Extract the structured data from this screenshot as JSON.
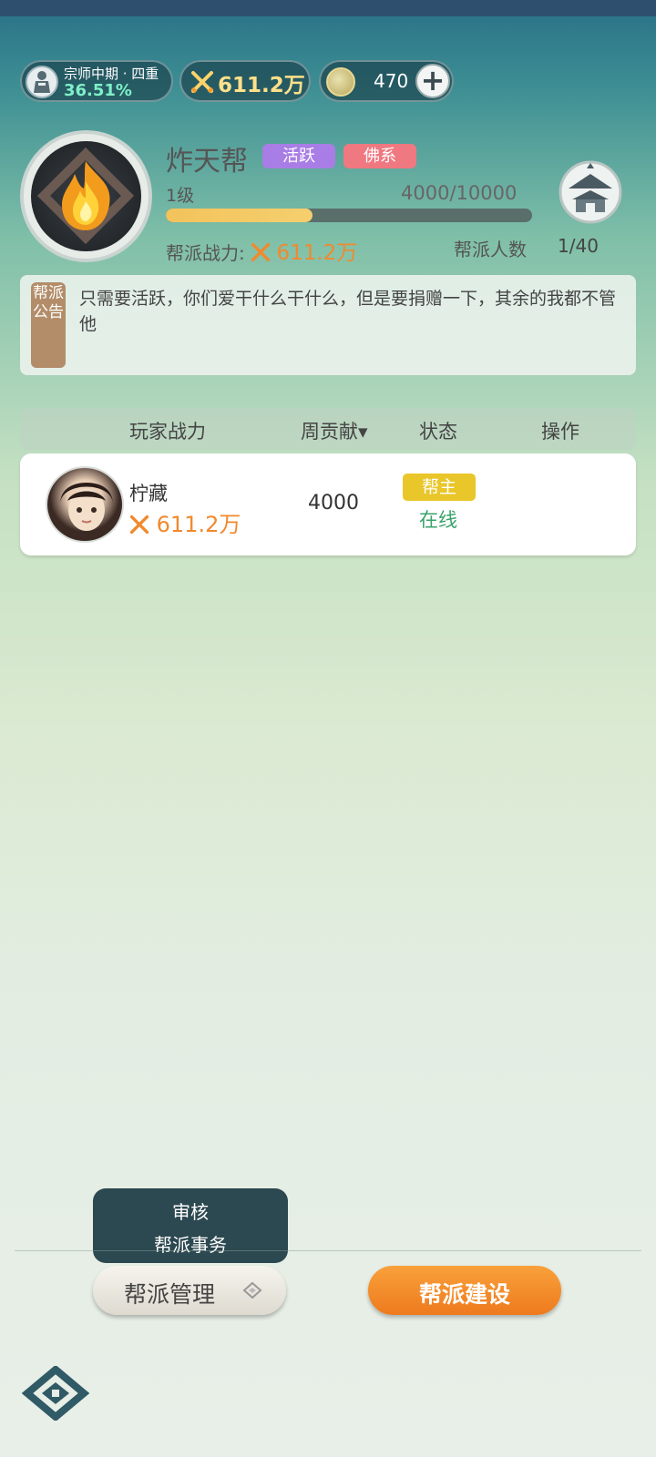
{
  "rank": {
    "title": "宗师中期 · 四重",
    "percent": "36.51%"
  },
  "power": {
    "value": "611.2万"
  },
  "currency": {
    "value": "470"
  },
  "guild": {
    "name": "炸天帮",
    "tags": [
      "活跃",
      "佛系"
    ],
    "level": "1级",
    "exp": "4000/10000",
    "exp_progress": 0.4,
    "power_label": "帮派战力:",
    "power_value": "611.2万",
    "members_label": "帮派人数",
    "members_value": "1/40"
  },
  "notice": {
    "tag": "帮派公告",
    "text": "只需要活跃，你们爱干什么干什么，但是要捐赠一下，其余的我都不管他"
  },
  "table": {
    "headers": [
      "玩家战力",
      "周贡献▾",
      "状态",
      "操作"
    ],
    "rows": [
      {
        "name": "柠藏",
        "power": "611.2万",
        "contribution": "4000",
        "role": "帮主",
        "status": "在线"
      }
    ]
  },
  "popup": {
    "items": [
      "审核",
      "帮派事务"
    ]
  },
  "buttons": {
    "manage": "帮派管理",
    "build": "帮派建设"
  },
  "colors": {
    "accent_orange": "#f08a2e",
    "online_green": "#3aa36c",
    "tag_purple": "#a97de6",
    "tag_red": "#f07880"
  }
}
